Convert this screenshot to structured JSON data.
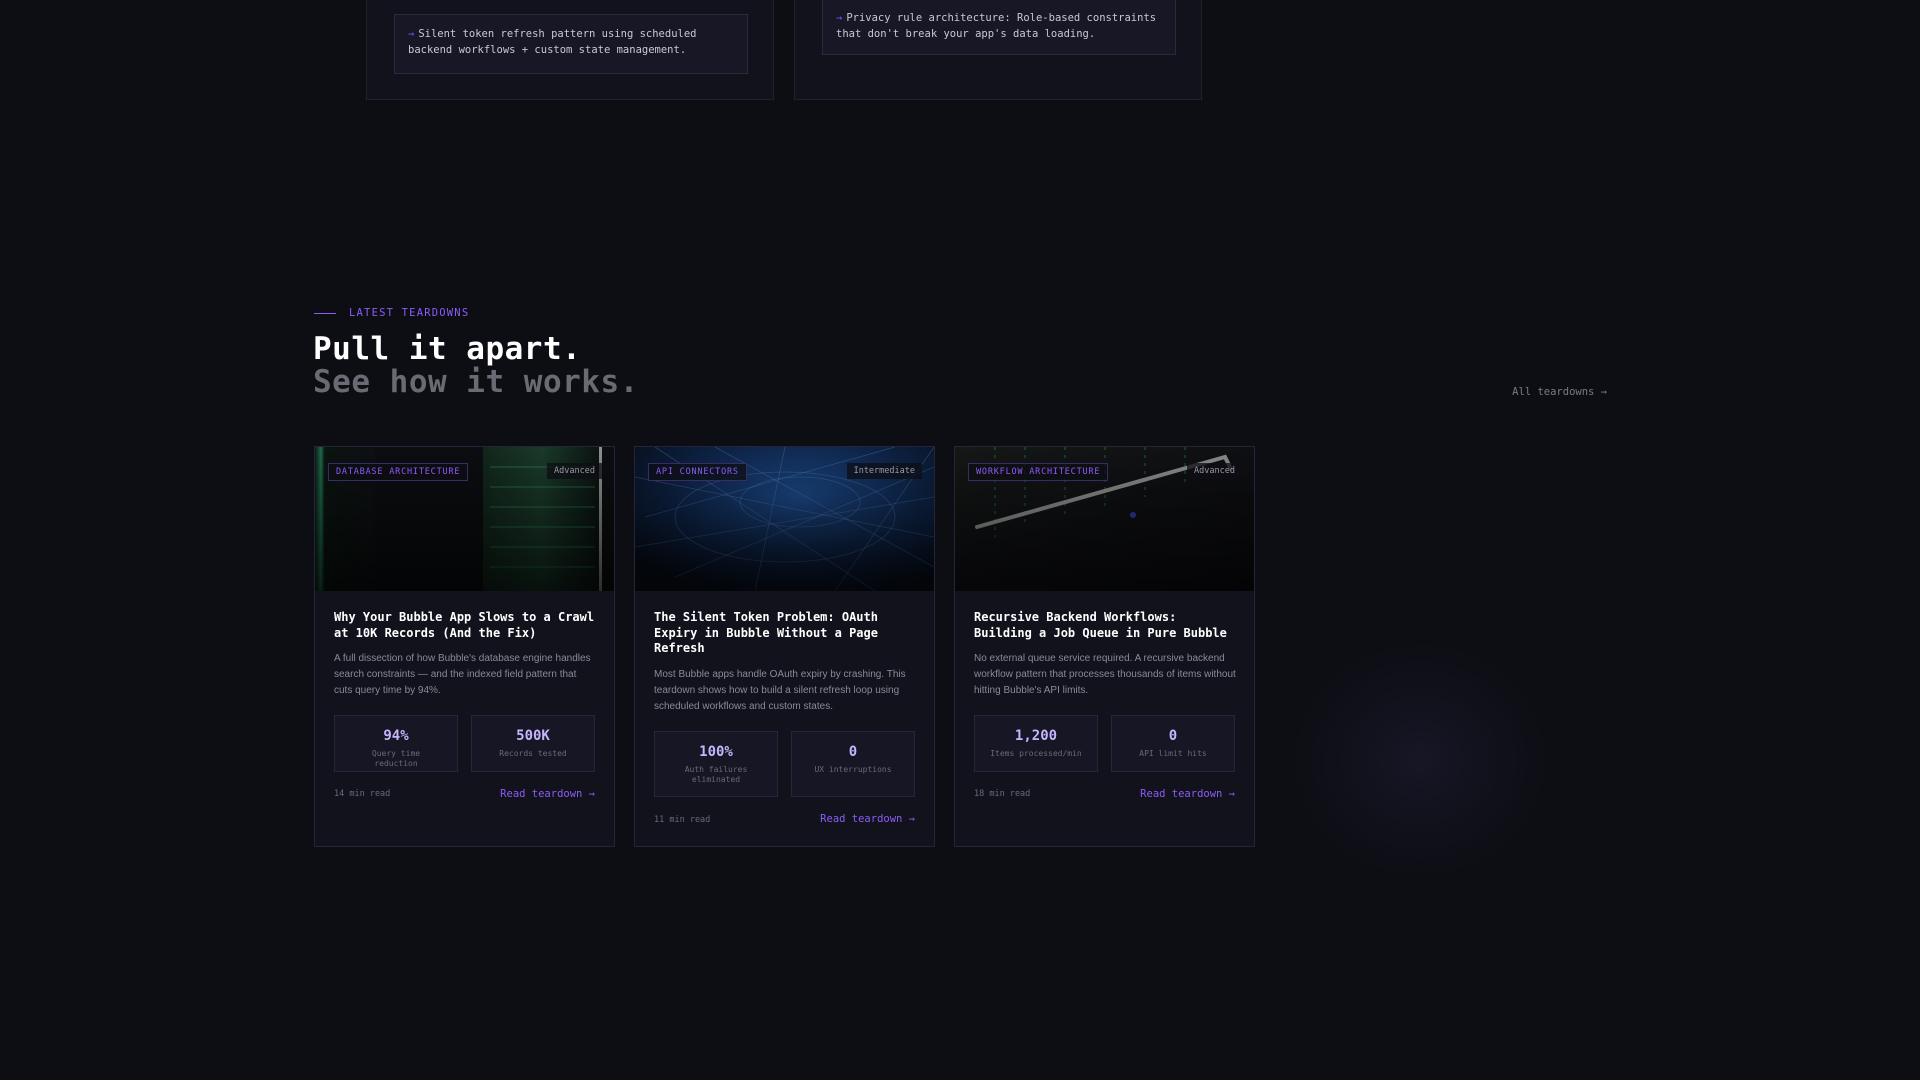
{
  "previous_section": {
    "cards": [
      {
        "quote": "Silent token refresh pattern using scheduled backend workflows + custom state management."
      },
      {
        "quote": "Privacy rule architecture: Role-based constraints that don't break your app's data loading."
      }
    ]
  },
  "section": {
    "eyebrow": "LATEST TEARDOWNS",
    "title_line1": "Pull it apart.",
    "title_line2": "See how it works.",
    "all_link": "All teardowns →"
  },
  "colors": {
    "background": "#0d0d14",
    "card": "#12121c",
    "accent": "#8b5cf6",
    "stat_value": "#c4b5fd"
  },
  "teardowns": [
    {
      "tag": "DATABASE ARCHITECTURE",
      "level": "Advanced",
      "title": "Why Your Bubble App Slows to a Crawl at 10K Records (And the Fix)",
      "description": "A full dissection of how Bubble's database engine handles search constraints — and the indexed field pattern that cuts query time by 94%.",
      "stats": [
        {
          "value": "94%",
          "label": "Query time reduction"
        },
        {
          "value": "500K",
          "label": "Records tested"
        }
      ],
      "read_time": "14 min read",
      "cta": "Read teardown →"
    },
    {
      "tag": "API CONNECTORS",
      "level": "Intermediate",
      "title": "The Silent Token Problem: OAuth Expiry in Bubble Without a Page Refresh",
      "description": "Most Bubble apps handle OAuth expiry by crashing. This teardown shows how to build a silent refresh loop using scheduled workflows and custom states.",
      "stats": [
        {
          "value": "100%",
          "label": "Auth failures eliminated"
        },
        {
          "value": "0",
          "label": "UX interruptions"
        }
      ],
      "read_time": "11 min read",
      "cta": "Read teardown →"
    },
    {
      "tag": "WORKFLOW ARCHITECTURE",
      "level": "Advanced",
      "title": "Recursive Backend Workflows: Building a Job Queue in Pure Bubble",
      "description": "No external queue service required. A recursive backend workflow pattern that processes thousands of items without hitting Bubble's API limits.",
      "stats": [
        {
          "value": "1,200",
          "label": "Items processed/min"
        },
        {
          "value": "0",
          "label": "API limit hits"
        }
      ],
      "read_time": "18 min read",
      "cta": "Read teardown →"
    }
  ]
}
